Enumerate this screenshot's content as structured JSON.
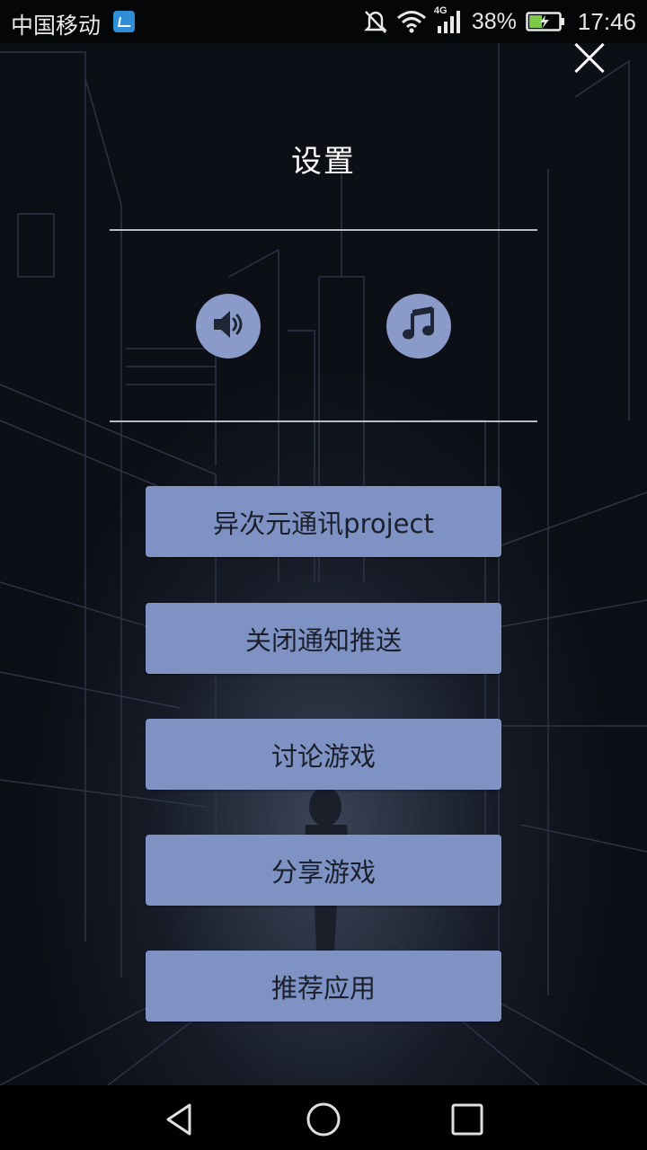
{
  "status_bar": {
    "carrier": "中国移动",
    "network": "4G",
    "battery": "38%",
    "time": "17:46"
  },
  "settings": {
    "title": "设置",
    "buttons": [
      {
        "label": "异次元通讯project"
      },
      {
        "label": "关闭通知推送"
      },
      {
        "label": "讨论游戏"
      },
      {
        "label": "分享游戏"
      },
      {
        "label": "推荐应用"
      }
    ]
  },
  "icons": {
    "sound": "speaker-icon",
    "music": "music-note-icon",
    "close": "close-icon"
  },
  "colors": {
    "button_bg": "#7e92c4",
    "round_button_bg": "#8a9bc9",
    "background": "#0d1018"
  }
}
